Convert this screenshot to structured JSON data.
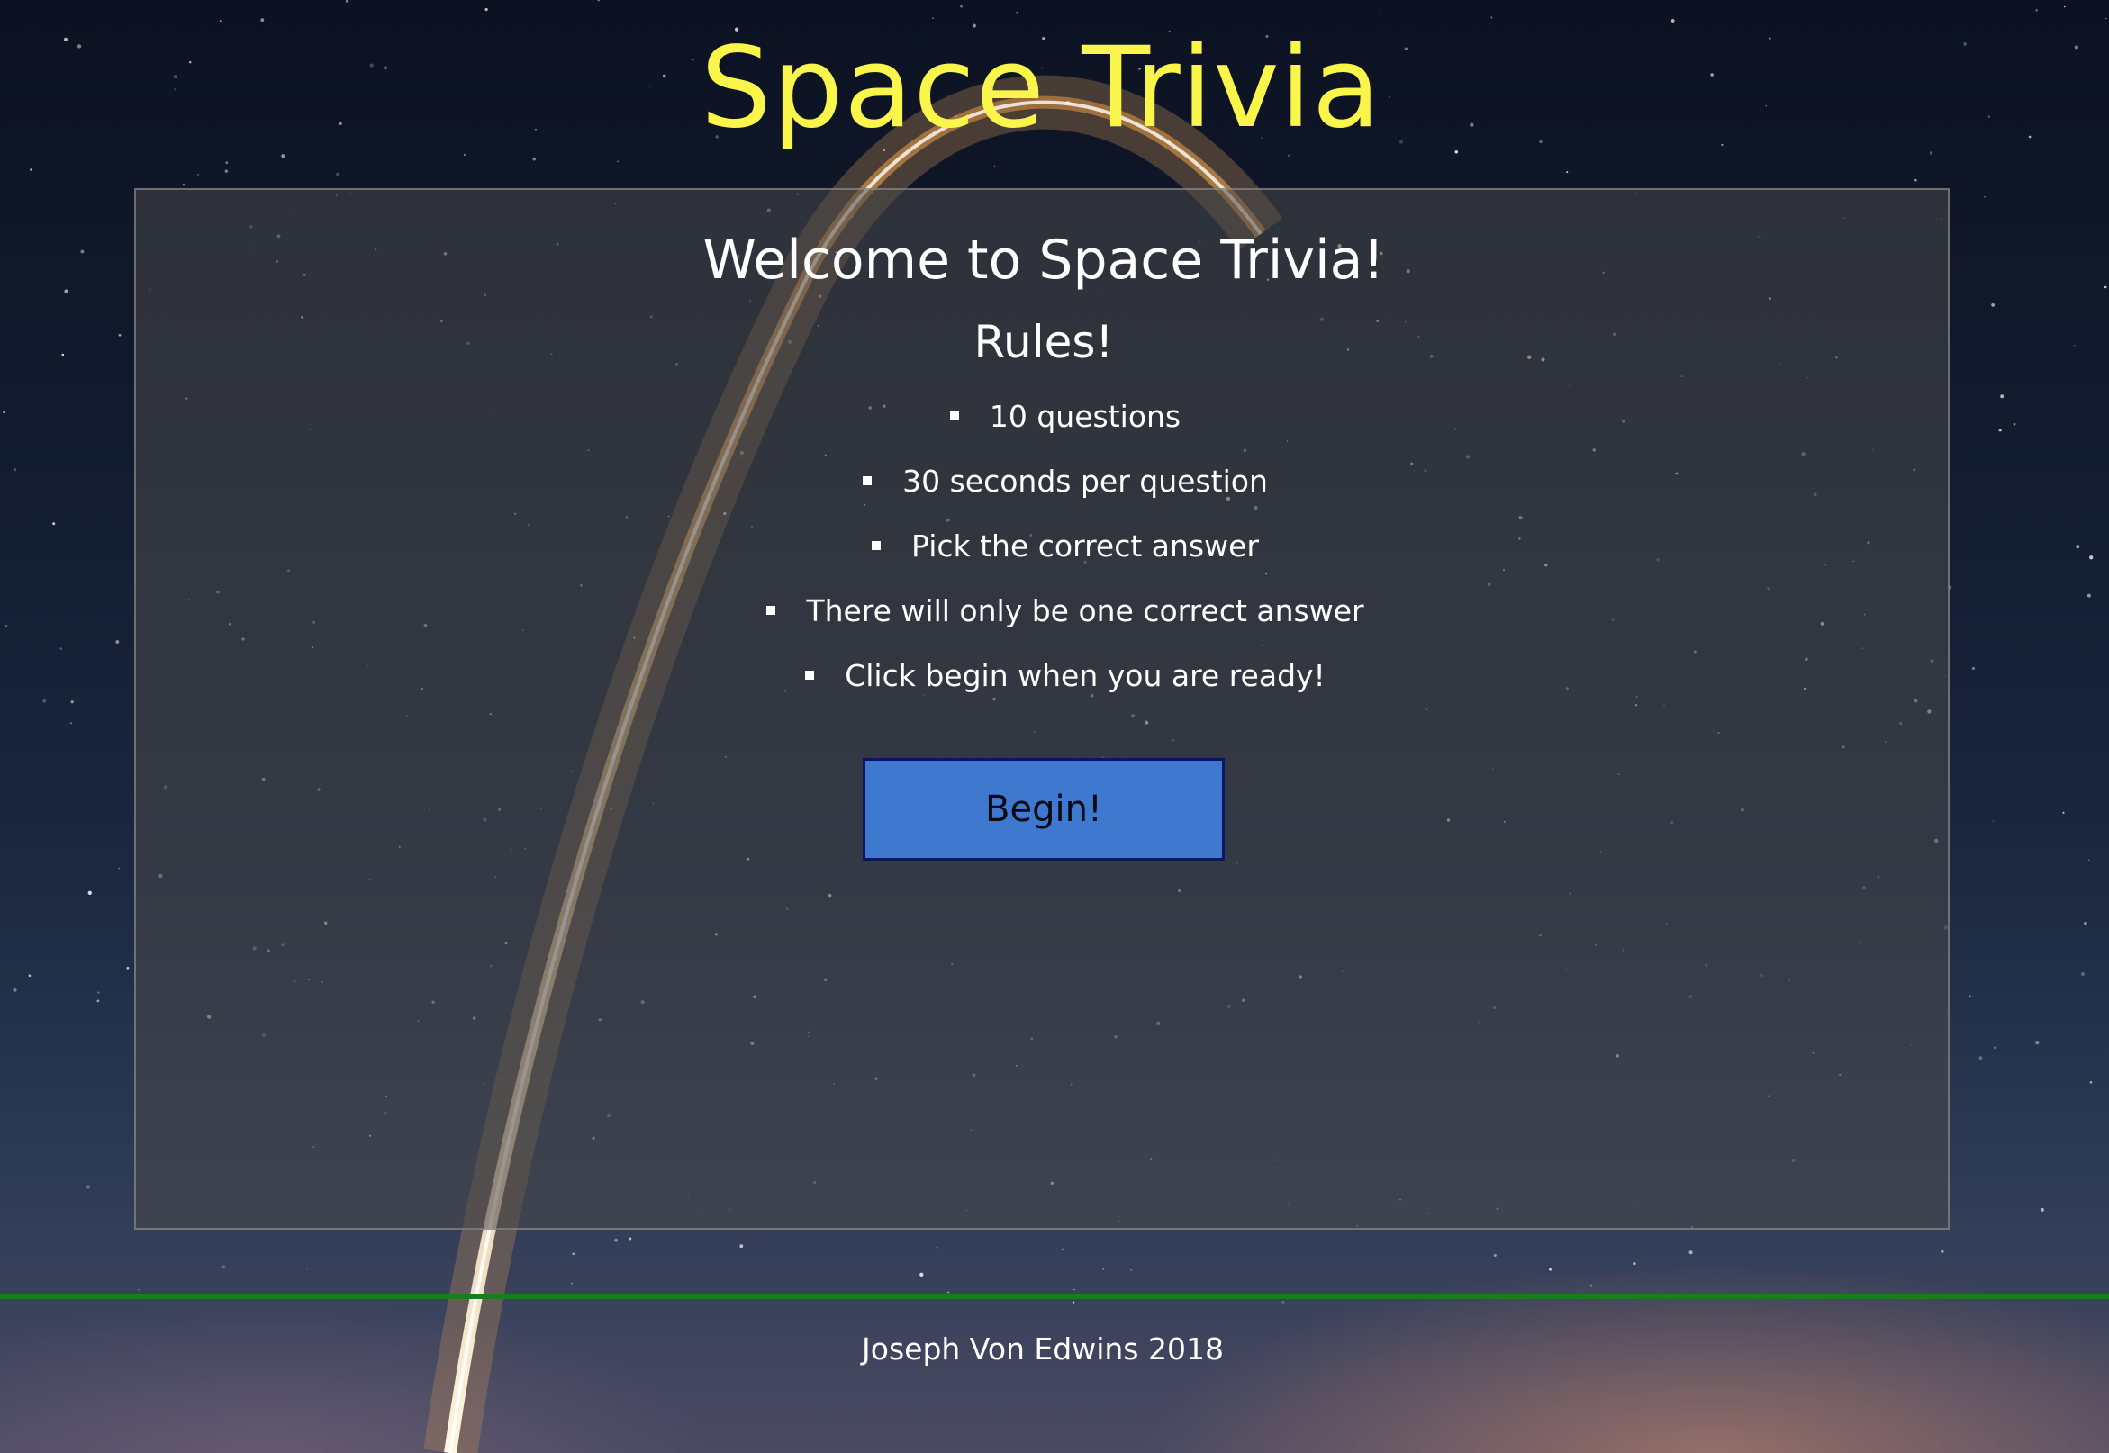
{
  "header": {
    "title": "Space Trivia"
  },
  "panel": {
    "welcome": "Welcome to Space Trivia!",
    "rules_heading": "Rules!",
    "rules": [
      "10 questions",
      "30 seconds per question",
      "Pick the correct answer",
      "There will only be one correct answer",
      "Click begin when you are ready!"
    ],
    "begin_label": "Begin!"
  },
  "footer": {
    "text": "Joseph Von Edwins 2018"
  },
  "colors": {
    "title": "#f9f54a",
    "button_bg": "#3f78cf",
    "button_border": "#0e1560",
    "footer_divider": "#1b7c1f",
    "panel_bg": "rgba(72,72,72,0.55)"
  }
}
